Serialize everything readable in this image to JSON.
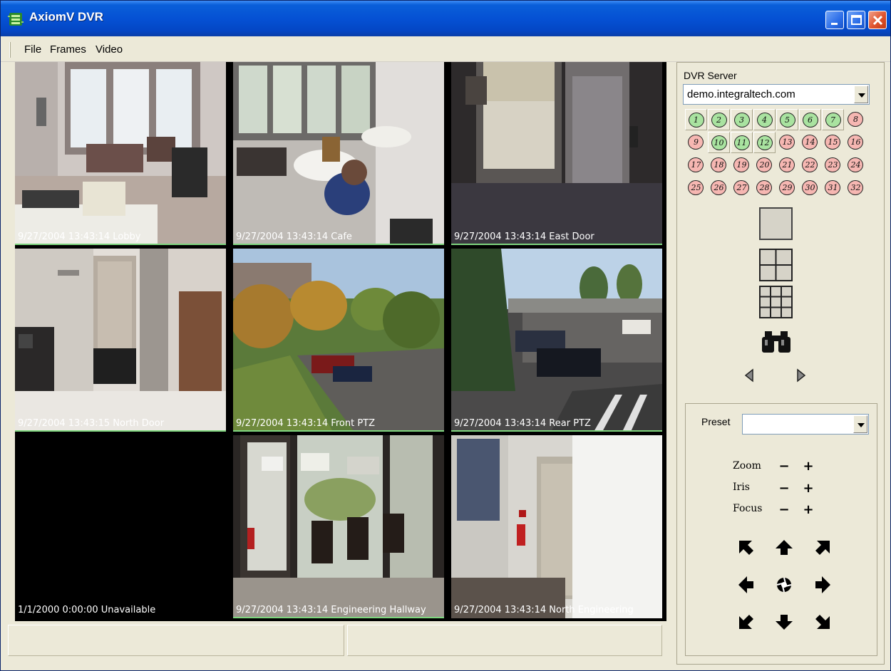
{
  "window": {
    "title": "AxiomV DVR",
    "accent": "#0551d4"
  },
  "menu": {
    "items": [
      "File",
      "Frames",
      "Video"
    ]
  },
  "cameras": [
    {
      "caption": "9/27/2004 13:43:14 Lobby",
      "status": "live"
    },
    {
      "caption": "9/27/2004 13:43:14 Cafe",
      "status": "live"
    },
    {
      "caption": "9/27/2004 13:43:14 East Door",
      "status": "live"
    },
    {
      "caption": "9/27/2004 13:43:15 North Door",
      "status": "live"
    },
    {
      "caption": "9/27/2004 13:43:14 Front PTZ",
      "status": "live"
    },
    {
      "caption": "9/27/2004 13:43:14 Rear PTZ",
      "status": "live"
    },
    {
      "caption": "1/1/2000 0:00:00 Unavailable",
      "status": "unavailable"
    },
    {
      "caption": "9/27/2004 13:43:14 Engineering Hallway",
      "status": "live"
    },
    {
      "caption": "9/27/2004 13:43:14 North Engineering",
      "status": "selected"
    }
  ],
  "panel": {
    "dvr_label": "DVR Server",
    "dvr_value": "demo.integraltech.com",
    "camera_numbers": [
      "1",
      "2",
      "3",
      "4",
      "5",
      "6",
      "7",
      "8",
      "9",
      "10",
      "11",
      "12",
      "13",
      "14",
      "15",
      "16",
      "17",
      "18",
      "19",
      "20",
      "21",
      "22",
      "23",
      "24",
      "25",
      "26",
      "27",
      "28",
      "29",
      "30",
      "31",
      "32"
    ],
    "camera_on_color": "#a9e3a0",
    "camera_off_color": "#f6b7b2",
    "layout_icons": [
      "single-view-icon",
      "quad-view-icon",
      "nine-view-icon",
      "binoculars-icon",
      "previous-icon",
      "next-icon"
    ],
    "preset_label": "Preset",
    "preset_value": "",
    "zoom_label": "Zoom",
    "iris_label": "Iris",
    "focus_label": "Focus",
    "minus": "−",
    "plus": "+",
    "selected_color": "#d10000"
  }
}
